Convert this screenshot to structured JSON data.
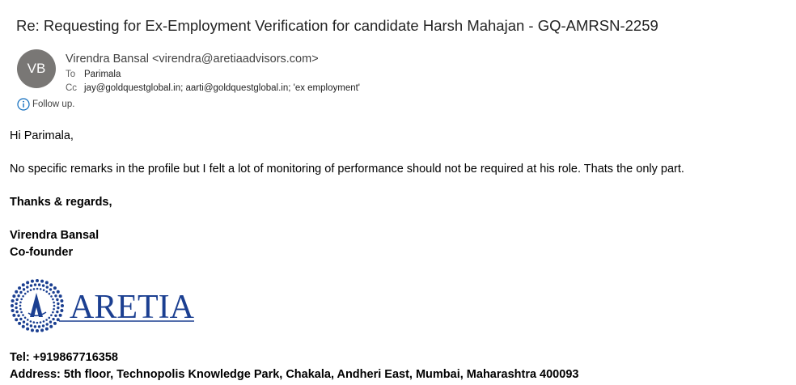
{
  "email": {
    "subject": "Re: Requesting for Ex-Employment Verification for candidate Harsh Mahajan - GQ-AMRSN-2259",
    "sender": {
      "initials": "VB",
      "display": "Virendra Bansal <virendra@aretiaadvisors.com>"
    },
    "to": {
      "label": "To",
      "value": "Parimala"
    },
    "cc": {
      "label": "Cc",
      "value": "jay@goldquestglobal.in; aarti@goldquestglobal.in; 'ex employment'"
    },
    "flag": {
      "text": "Follow up.",
      "icon": "info-icon"
    }
  },
  "body": {
    "greeting": "Hi Parimala,",
    "message": "No specific remarks in the profile but I felt a lot of monitoring of performance should not be required at his role.  Thats the only part.",
    "closing": "Thanks & regards,",
    "signature_name": "Virendra Bansal",
    "signature_title": "Co-founder",
    "logo_text": "ARETIA",
    "tel": "Tel: +919867716358",
    "address": "Address: 5th floor, Technopolis Knowledge Park, Chakala, Andheri East, Mumbai, Maharashtra 400093"
  },
  "colors": {
    "avatar_bg": "#797775",
    "logo_blue": "#1b3f91",
    "info_icon": "#0f6cbd"
  }
}
